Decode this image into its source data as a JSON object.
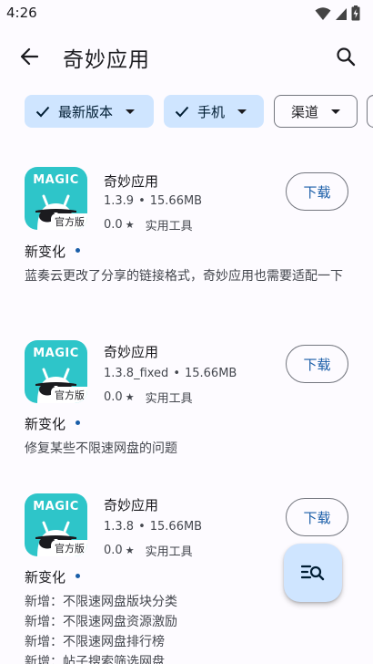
{
  "status_bar": {
    "time": "4:26"
  },
  "app_bar": {
    "title": "奇妙应用"
  },
  "filters": [
    {
      "label": "最新版本",
      "selected": true
    },
    {
      "label": "手机",
      "selected": true
    },
    {
      "label": "渠道",
      "selected": false
    }
  ],
  "entries": [
    {
      "icon_text": "MAGIC",
      "badge": "官方版",
      "name": "奇妙应用",
      "version": "1.3.9",
      "size": "15.66MB",
      "separator": "•",
      "rating": "0.0",
      "star": "★",
      "category": "实用工具",
      "download_label": "下载",
      "changes_title": "新变化",
      "changes": [
        "蓝奏云更改了分享的链接格式，奇妙应用也需要适配一下"
      ]
    },
    {
      "icon_text": "MAGIC",
      "badge": "官方版",
      "name": "奇妙应用",
      "version": "1.3.8_fixed",
      "size": "15.66MB",
      "separator": "•",
      "rating": "0.0",
      "star": "★",
      "category": "实用工具",
      "download_label": "下载",
      "changes_title": "新变化",
      "changes": [
        "修复某些不限速网盘的问题"
      ]
    },
    {
      "icon_text": "MAGIC",
      "badge": "官方版",
      "name": "奇妙应用",
      "version": "1.3.8",
      "size": "15.66MB",
      "separator": "•",
      "rating": "0.0",
      "star": "★",
      "category": "实用工具",
      "download_label": "下载",
      "changes_title": "新变化",
      "changes": [
        "新增：不限速网盘版块分类",
        "新增：不限速网盘资源激励",
        "新增：不限速网盘排行榜",
        "新增：帖子搜索筛选网盘"
      ]
    }
  ],
  "colors": {
    "accent": "#1a5ea8",
    "chip_selected": "#cfe5ff",
    "icon_bg": "#2ec5c9",
    "background": "#fdfbff"
  },
  "icons": [
    "wifi-icon",
    "signal-icon",
    "battery-icon",
    "back-arrow-icon",
    "search-icon",
    "check-icon",
    "dropdown-caret-icon",
    "filter-search-icon"
  ]
}
